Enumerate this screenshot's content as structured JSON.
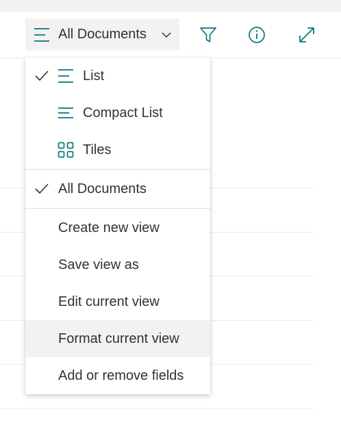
{
  "commandbar": {
    "view_button_label": "All Documents",
    "icons": [
      "filter-icon",
      "info-icon",
      "expand-icon"
    ]
  },
  "view_menu": {
    "layout_items": [
      {
        "label": "List",
        "checked": true,
        "icon": "list-icon"
      },
      {
        "label": "Compact List",
        "checked": false,
        "icon": "compact-list-icon"
      },
      {
        "label": "Tiles",
        "checked": false,
        "icon": "tiles-icon"
      }
    ],
    "view_items": [
      {
        "label": "All Documents",
        "checked": true
      }
    ],
    "action_items": [
      {
        "label": "Create new view"
      },
      {
        "label": "Save view as"
      },
      {
        "label": "Edit current view"
      },
      {
        "label": "Format current view",
        "hovered": true
      },
      {
        "label": "Add or remove fields"
      }
    ]
  },
  "colors": {
    "accent": "#03787c",
    "hover_bg": "#f3f2f1",
    "text": "#323130"
  }
}
